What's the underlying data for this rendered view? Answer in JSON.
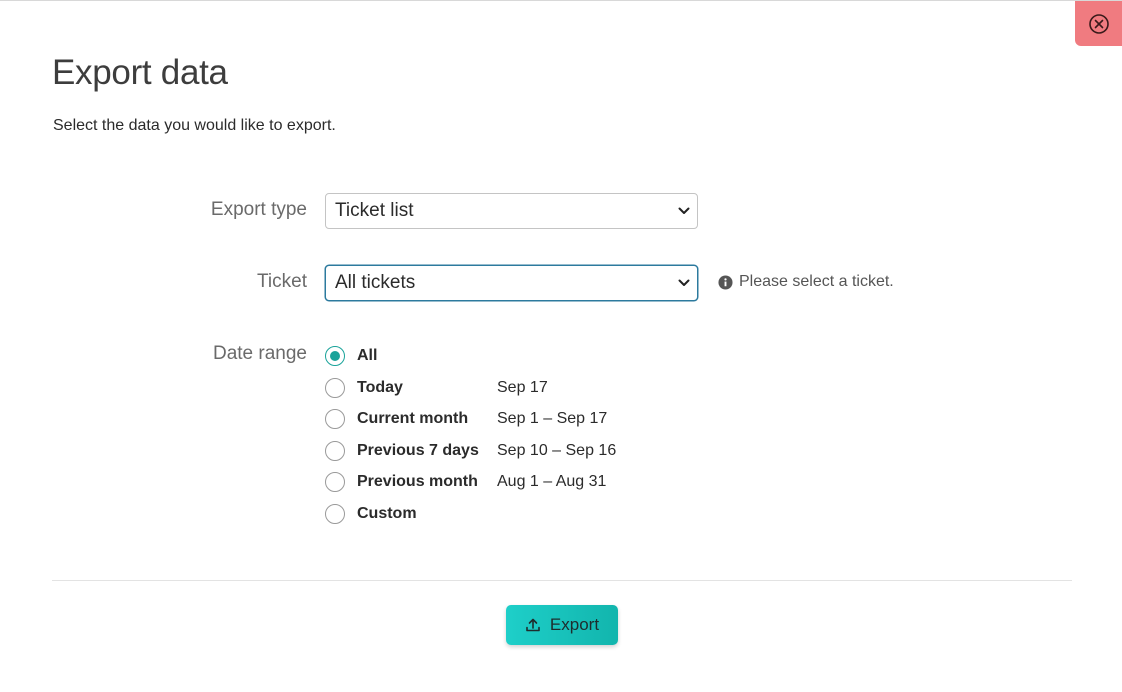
{
  "dialog": {
    "title": "Export data",
    "subtitle": "Select the data you would like to export."
  },
  "close_button": {
    "icon": "close-circle-icon",
    "background": "#f07b80"
  },
  "export_type": {
    "label": "Export type",
    "value": "Ticket list"
  },
  "ticket": {
    "label": "Ticket",
    "value": "All tickets",
    "hint": "Please select a ticket.",
    "hint_icon": "info-icon"
  },
  "date_range": {
    "label": "Date range",
    "options": [
      {
        "label": "All",
        "range": "",
        "checked": true
      },
      {
        "label": "Today",
        "range": "Sep 17",
        "checked": false
      },
      {
        "label": "Current month",
        "range": "Sep 1 – Sep 17",
        "checked": false
      },
      {
        "label": "Previous 7 days",
        "range": "Sep 10 – Sep 16",
        "checked": false
      },
      {
        "label": "Previous month",
        "range": "Aug 1 – Aug 31",
        "checked": false
      },
      {
        "label": "Custom",
        "range": "",
        "checked": false
      }
    ]
  },
  "export_button": {
    "label": "Export",
    "icon": "upload-icon",
    "color": "#1ecfc9"
  },
  "colors": {
    "accent": "#1aa39a",
    "focus_border": "#2c7a9e"
  }
}
